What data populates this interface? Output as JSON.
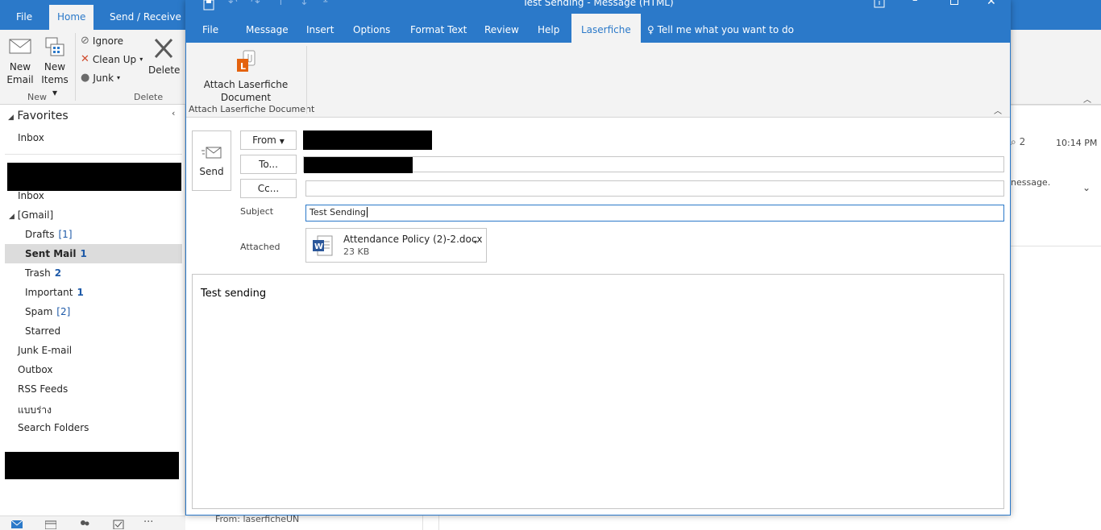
{
  "main_window": {
    "tabs": [
      "File",
      "Home",
      "Send / Receive"
    ],
    "active_tab": "Home",
    "ribbon": {
      "new_email": [
        "New",
        "Email"
      ],
      "new_items": [
        "New",
        "Items"
      ],
      "ignore": "Ignore",
      "clean_up": "Clean Up",
      "junk": "Junk",
      "delete": "Delete",
      "group_new": "New",
      "group_delete": "Delete"
    },
    "favorites_label": "Favorites",
    "favorites_inbox": "Inbox",
    "folders": [
      {
        "label": "Inbox",
        "count": ""
      },
      {
        "label": "[Gmail]",
        "count": ""
      },
      {
        "label": "Drafts",
        "count": "[1]"
      },
      {
        "label": "Sent Mail",
        "count": "1"
      },
      {
        "label": "Trash",
        "count": "2"
      },
      {
        "label": "Important",
        "count": "1"
      },
      {
        "label": "Spam",
        "count": "[2]"
      },
      {
        "label": "Starred",
        "count": ""
      },
      {
        "label": "Junk E-mail",
        "count": ""
      },
      {
        "label": "Outbox",
        "count": ""
      },
      {
        "label": "RSS Feeds",
        "count": ""
      },
      {
        "label": "แบบร่าง",
        "count": ""
      },
      {
        "label": "Search Folders",
        "count": ""
      }
    ],
    "right_pane": {
      "attachment_count": "2",
      "time": "10:14 PM",
      "snippet": "nessage."
    },
    "bottom_from": "From: laserficheUN"
  },
  "compose": {
    "title": "Test Sending  -  Message (HTML)",
    "tabs": [
      "File",
      "Message",
      "Insert",
      "Options",
      "Format Text",
      "Review",
      "Help",
      "Laserfiche"
    ],
    "active_tab": "Laserfiche",
    "tell_me": "Tell me what you want to do",
    "ribbon": {
      "attach_button": [
        "Attach Laserfiche",
        "Document"
      ],
      "group_label": "Attach Laserfiche Document"
    },
    "send_label": "Send",
    "from_label": "From",
    "to_label": "To...",
    "cc_label": "Cc...",
    "subject_label": "Subject",
    "subject_value": "Test Sending",
    "attached_label": "Attached",
    "attachment": {
      "name": "Attendance Policy (2)-2.docx",
      "size": "23 KB"
    },
    "body_text": "Test sending"
  },
  "colors": {
    "accent": "#2b79c9",
    "ribbon_bg": "#f3f3f3",
    "count_blue": "#1e5aa8",
    "laserfiche_orange": "#e4620e"
  }
}
